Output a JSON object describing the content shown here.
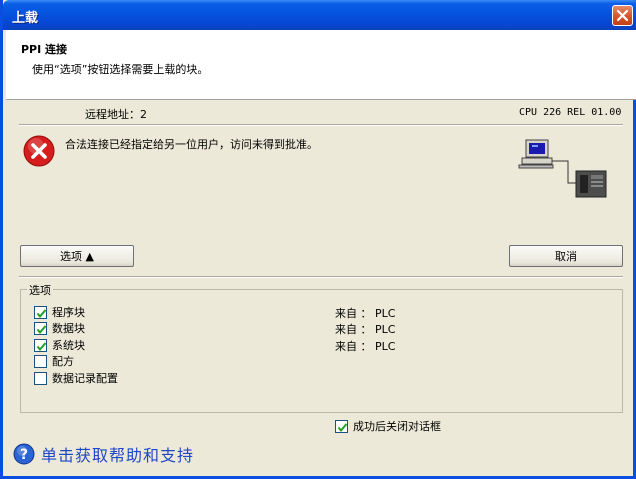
{
  "window": {
    "title": "上载"
  },
  "header": {
    "title": "PPI 连接",
    "subtitle": "使用“选项”按钮选择需要上载的块。"
  },
  "connection": {
    "remote_address": "远程地址：2",
    "cpu_info": "CPU 226 REL 01.00"
  },
  "error": {
    "message": "合法连接已经指定给另一位用户，访问未得到批准。",
    "icon": "error-icon"
  },
  "buttons": {
    "options_label": "选项 ▲",
    "cancel_label": "取消"
  },
  "options_group": {
    "legend": "选项",
    "items": [
      {
        "label": "程序块",
        "checked": true,
        "source": "来自 ： PLC"
      },
      {
        "label": "数据块",
        "checked": true,
        "source": "来自 ： PLC"
      },
      {
        "label": "系统块",
        "checked": true,
        "source": "来自 ： PLC"
      },
      {
        "label": "配方",
        "checked": false,
        "source": ""
      },
      {
        "label": "数据记录配置",
        "checked": false,
        "source": ""
      }
    ]
  },
  "close_after_success": {
    "label": "成功后关闭对话框",
    "checked": true
  },
  "help": {
    "label": "单击获取帮助和支持"
  },
  "colors": {
    "title_bar": "#0553e0",
    "help_link": "#1f47c6",
    "error_red": "#d61c1c"
  }
}
